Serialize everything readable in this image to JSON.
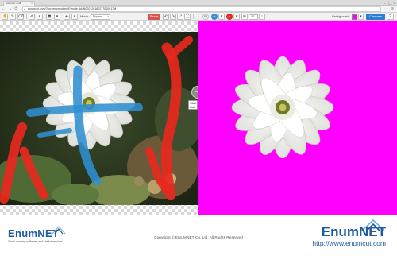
{
  "browser": {
    "tab_title": "Enumcut :: edit",
    "tab_close": "×",
    "window_controls": [
      "–",
      "▢",
      "×"
    ],
    "url": "enumcut.com/?lcp=enumcut/edit?mode_id=N020_20160217000017M",
    "nav": {
      "back": "←",
      "forward": "→",
      "reload": "⟳"
    },
    "menu": "≡"
  },
  "toolbar": {
    "mode_label": "Mode :",
    "mode_value": "Normal",
    "reset_label": "Reset",
    "zoom_value": "15",
    "background_label": "Background",
    "background_color": "#ff00ff",
    "compare_label": "Compare"
  },
  "workspace": {
    "start_cut_label": "Start Cut",
    "arrow_glyph": "➜",
    "result_bg_color": "#ff00ff"
  },
  "footer": {
    "logo_left": "EnumNET",
    "tagline": "Good-working software and useful services",
    "copyright": "Copyright © ENUMNET Co. Ltd. All Rights Reserved",
    "logo_right": "EnumNET",
    "site_url": "http://www.enumcut.com"
  },
  "colors": {
    "foreground_mark": "#2f8fd0",
    "background_mark": "#e8281e",
    "brand": "#1e5aa0",
    "reset": "#d9534f",
    "compare": "#2a7fd4"
  },
  "icons": [
    "hand-icon",
    "pen-icon",
    "eraser-icon",
    "brush-icon",
    "undo-icon",
    "redo-icon",
    "zoom-fit-icon",
    "fullscreen-icon",
    "target-icon",
    "plus-color-icon",
    "minus-color-icon",
    "zoom-icon"
  ]
}
